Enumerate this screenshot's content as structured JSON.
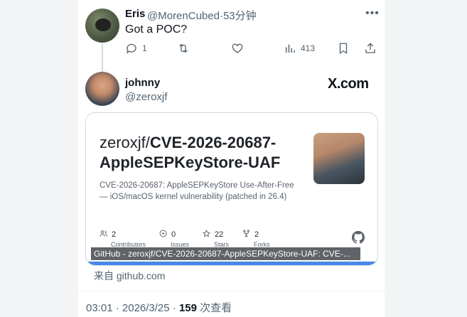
{
  "reply": {
    "author_name": "Eris",
    "author_handle": "@MorenCubed",
    "separator": "·",
    "time_ago": "53分钟",
    "text": "Got a POC?",
    "actions": {
      "reply_count": "1",
      "views_count": "413"
    }
  },
  "quoted": {
    "author_name": "johnny",
    "author_handle": "@zeroxjf",
    "brand": "X.com"
  },
  "card": {
    "repo_owner": "zeroxjf/",
    "repo_name": "CVE-2026-20687-AppleSEPKeyStore-UAF",
    "description": "CVE-2026-20687: AppleSEPKeyStore Use-After-Free — iOS/macOS kernel vulnerability (patched in 26.4)",
    "stats": [
      {
        "value": "2",
        "label": "Contributors"
      },
      {
        "value": "0",
        "label": "Issues"
      },
      {
        "value": "22",
        "label": "Stars"
      },
      {
        "value": "2",
        "label": "Forks"
      }
    ],
    "accent_color": "#4a86e8"
  },
  "tooltip": "GitHub - zeroxjf/CVE-2026-20687-AppleSEPKeyStore-UAF: CVE-...",
  "from_link": "来自 github.com",
  "footer": {
    "time": "03:01",
    "dot": "·",
    "date": "2026/3/25",
    "views_number": "159",
    "views_label": "次查看"
  }
}
